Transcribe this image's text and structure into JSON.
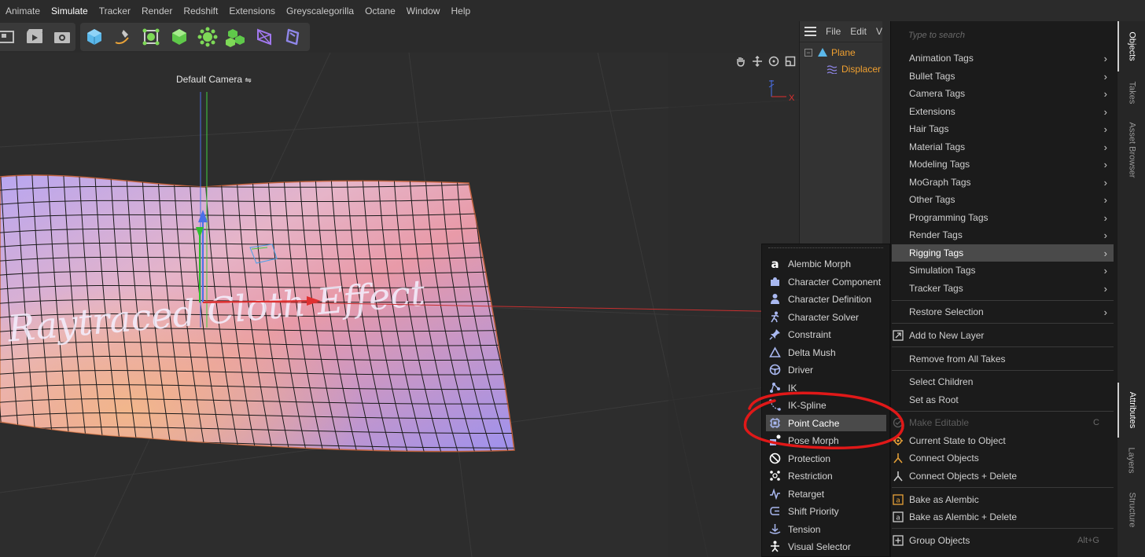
{
  "menubar": {
    "items": [
      {
        "label": "Animate"
      },
      {
        "label": "Simulate"
      },
      {
        "label": "Tracker"
      },
      {
        "label": "Render"
      },
      {
        "label": "Redshift"
      },
      {
        "label": "Extensions"
      },
      {
        "label": "Greyscalegorilla"
      },
      {
        "label": "Octane"
      },
      {
        "label": "Window"
      },
      {
        "label": "Help"
      }
    ]
  },
  "toolbar": {
    "icons": [
      "render-view-icon",
      "render-icon",
      "render-settings-icon",
      "cube-icon",
      "pen-spline-icon",
      "subdivision-icon",
      "extrude-icon",
      "cloner-icon",
      "mograph-icon",
      "deformer-icon",
      "field-icon"
    ]
  },
  "viewport": {
    "camera_label": "Default Camera",
    "axis_x_label": "X",
    "mesh_text": "Raytraced Cloth Effect"
  },
  "object_manager": {
    "menu": [
      "File",
      "Edit",
      "V"
    ],
    "objects": [
      {
        "label": "Plane",
        "level": 0
      },
      {
        "label": "Displacer",
        "level": 1
      }
    ]
  },
  "tag_menu": {
    "search_placeholder": "Type to search",
    "items": [
      {
        "label": "Animation Tags",
        "submenu": true
      },
      {
        "label": "Bullet Tags",
        "submenu": true
      },
      {
        "label": "Camera Tags",
        "submenu": true
      },
      {
        "label": "Extensions",
        "submenu": true
      },
      {
        "label": "Hair Tags",
        "submenu": true
      },
      {
        "label": "Material Tags",
        "submenu": true
      },
      {
        "label": "Modeling Tags",
        "submenu": true
      },
      {
        "label": "MoGraph Tags",
        "submenu": true
      },
      {
        "label": "Other Tags",
        "submenu": true
      },
      {
        "label": "Programming Tags",
        "submenu": true
      },
      {
        "label": "Render Tags",
        "submenu": true
      },
      {
        "label": "Rigging Tags",
        "submenu": true,
        "highlighted": true
      },
      {
        "label": "Simulation Tags",
        "submenu": true
      },
      {
        "label": "Tracker Tags",
        "submenu": true
      },
      {
        "label": "Restore Selection",
        "submenu": true
      },
      {
        "label": "Add to New Layer"
      },
      {
        "label": "Remove from All Takes"
      },
      {
        "label": "Select Children"
      },
      {
        "label": "Set as Root"
      },
      {
        "label": "Make Editable",
        "shortcut": "C",
        "disabled": true
      },
      {
        "label": "Current State to Object"
      },
      {
        "label": "Connect Objects"
      },
      {
        "label": "Connect Objects + Delete"
      },
      {
        "label": "Bake as Alembic"
      },
      {
        "label": "Bake as Alembic + Delete"
      },
      {
        "label": "Group Objects",
        "shortcut": "Alt+G"
      }
    ]
  },
  "rigging_submenu": {
    "items": [
      {
        "label": "Alembic Morph",
        "icon": "alembic-icon"
      },
      {
        "label": "Character Component",
        "icon": "puzzle-icon"
      },
      {
        "label": "Character Definition",
        "icon": "person-icon"
      },
      {
        "label": "Character Solver",
        "icon": "running-person-icon"
      },
      {
        "label": "Constraint",
        "icon": "pin-icon"
      },
      {
        "label": "Delta Mush",
        "icon": "triangle-icon"
      },
      {
        "label": "Driver",
        "icon": "steering-wheel-icon"
      },
      {
        "label": "IK",
        "icon": "ik-icon"
      },
      {
        "label": "IK-Spline",
        "icon": "ik-spline-icon"
      },
      {
        "label": "Point Cache",
        "icon": "point-cache-icon",
        "highlighted": true
      },
      {
        "label": "Pose Morph",
        "icon": "pose-morph-icon"
      },
      {
        "label": "Protection",
        "icon": "protection-icon"
      },
      {
        "label": "Restriction",
        "icon": "restriction-icon"
      },
      {
        "label": "Retarget",
        "icon": "retarget-icon"
      },
      {
        "label": "Shift Priority",
        "icon": "shift-priority-icon"
      },
      {
        "label": "Tension",
        "icon": "tension-icon"
      },
      {
        "label": "Visual Selector",
        "icon": "visual-selector-icon"
      }
    ]
  },
  "right_tabs": [
    {
      "label": "Objects",
      "active": true
    },
    {
      "label": "Takes"
    },
    {
      "label": "Asset Browser"
    },
    {
      "label": "Attributes",
      "active": true
    },
    {
      "label": "Layers"
    },
    {
      "label": "Structure"
    }
  ],
  "colors": {
    "accent_orange": "#f0a030",
    "annotation_red": "#e01818",
    "menu_bg": "#1b1b1b",
    "highlight": "#4a4a4a",
    "icon_blue": "#7da2e8"
  }
}
